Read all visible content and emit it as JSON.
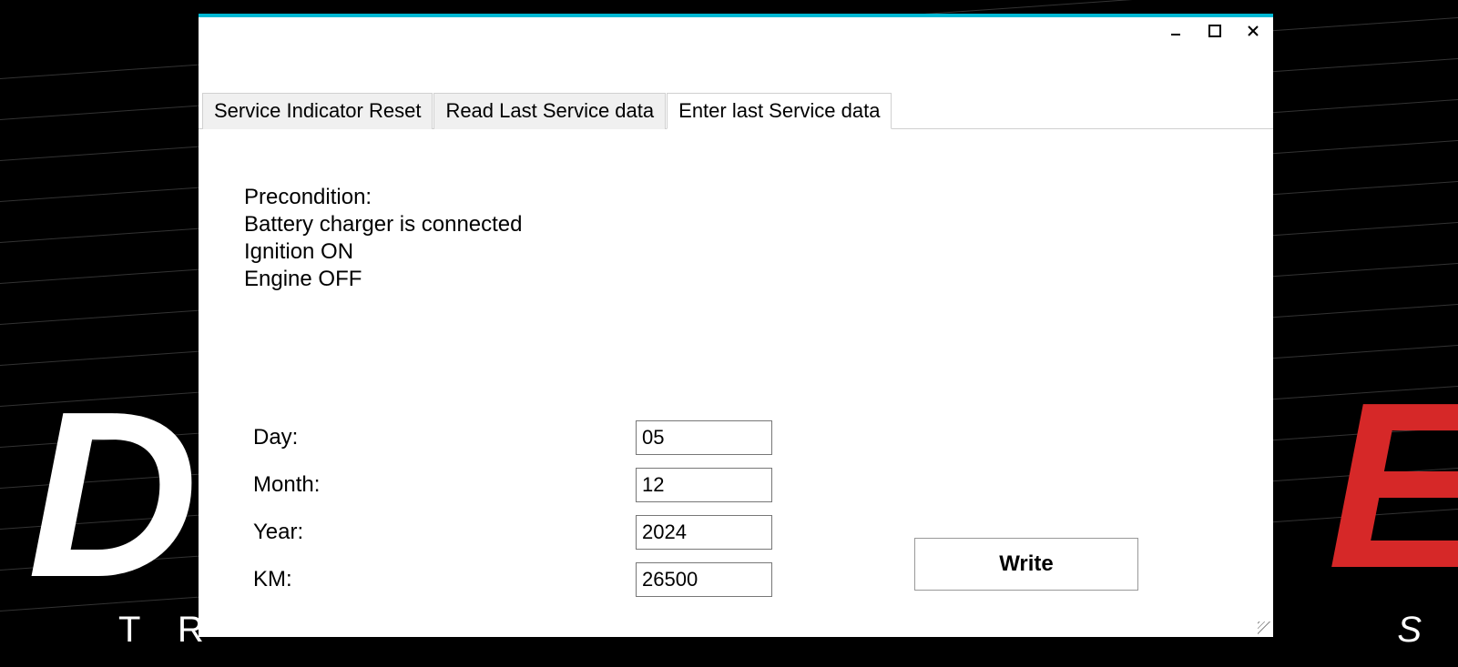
{
  "tabs": [
    {
      "label": "Service Indicator Reset"
    },
    {
      "label": "Read Last Service data"
    },
    {
      "label": "Enter last Service data"
    }
  ],
  "precondition": {
    "heading": "Precondition:",
    "line1": "Battery charger is connected",
    "line2": "Ignition ON",
    "line3": "Engine OFF"
  },
  "form": {
    "day": {
      "label": "Day:",
      "value": "05"
    },
    "month": {
      "label": "Month:",
      "value": "12"
    },
    "year": {
      "label": "Year:",
      "value": "2024"
    },
    "km": {
      "label": "KM:",
      "value": "26500"
    }
  },
  "buttons": {
    "write": "Write"
  },
  "bg": {
    "letter_d": "D",
    "letter_e": "E",
    "text_tr": "T R",
    "text_s": "S"
  }
}
